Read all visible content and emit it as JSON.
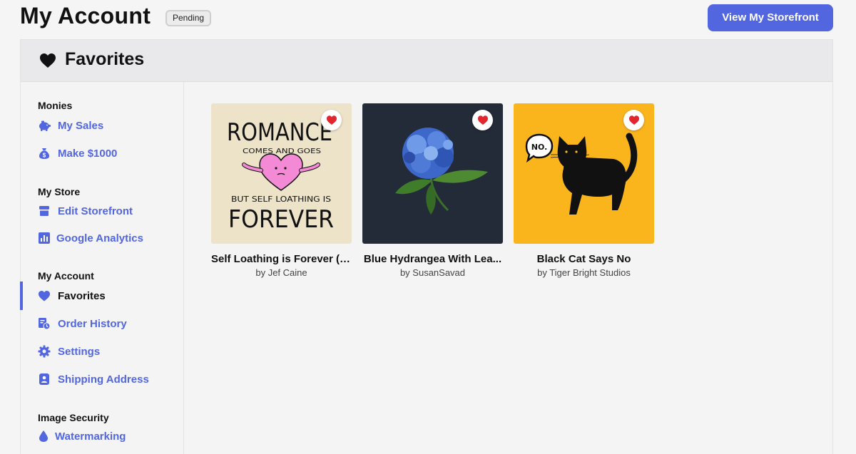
{
  "header": {
    "title": "My Account",
    "badge": "Pending",
    "storefront_button": "View My Storefront"
  },
  "panel": {
    "title": "Favorites",
    "icon": "heart-icon"
  },
  "sidebar": {
    "sections": [
      {
        "title": "Monies",
        "items": [
          {
            "label": "My Sales",
            "icon": "piggy-bank-icon"
          },
          {
            "label": "Make $1000",
            "icon": "money-bag-icon"
          }
        ]
      },
      {
        "title": "My Store",
        "items": [
          {
            "label": "Edit Storefront",
            "icon": "storefront-icon"
          },
          {
            "label": "Google Analytics",
            "icon": "bar-chart-icon"
          }
        ]
      },
      {
        "title": "My Account",
        "items": [
          {
            "label": "Favorites",
            "icon": "heart-icon",
            "active": true
          },
          {
            "label": "Order History",
            "icon": "receipt-clock-icon"
          },
          {
            "label": "Settings",
            "icon": "gear-icon"
          },
          {
            "label": "Shipping Address",
            "icon": "address-book-icon"
          }
        ]
      },
      {
        "title": "Image Security",
        "items": [
          {
            "label": "Watermarking",
            "icon": "droplet-icon"
          }
        ]
      }
    ]
  },
  "favorites": [
    {
      "title": "Self Loathing is Forever (c...",
      "artist": "by Jef Caine",
      "art_text": [
        "ROMANCE",
        "COMES AND GOES",
        "BUT SELF LOATHING IS",
        "FOREVER"
      ]
    },
    {
      "title": "Blue Hydrangea With Lea...",
      "artist": "by SusanSavad"
    },
    {
      "title": "Black Cat Says No",
      "artist": "by Tiger Bright Studios",
      "art_text": [
        "NO."
      ]
    }
  ],
  "colors": {
    "accent": "#5266e0",
    "heart_red": "#e2262d",
    "card1_bg": "#ede3c9",
    "card2_bg": "#232b38",
    "card3_bg": "#fbb51c"
  }
}
